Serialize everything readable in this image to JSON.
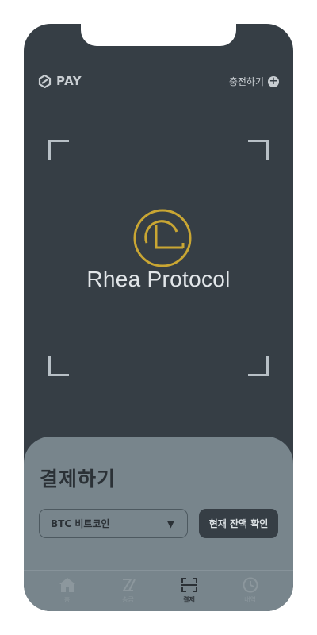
{
  "header": {
    "logo_text": "PAY",
    "charge_label": "충전하기",
    "charge_icon": "plus-circle-icon"
  },
  "scanner": {
    "brand_name": "Rhea Protocol",
    "brand_icon": "rhea-protocol-logo"
  },
  "payment": {
    "title": "결제하기",
    "coin_select_value": "BTC 비트코인",
    "balance_button_label": "현재 잔액 확인"
  },
  "tabs": [
    {
      "label": "홈",
      "icon": "home-icon",
      "active": false
    },
    {
      "label": "송금",
      "icon": "transfer-icon",
      "active": false
    },
    {
      "label": "결제",
      "icon": "scan-icon",
      "active": true
    },
    {
      "label": "내역",
      "icon": "clock-icon",
      "active": false
    }
  ],
  "colors": {
    "background": "#363e45",
    "sheet": "#78858c",
    "brand_gold": "#c9a633",
    "button_dark": "#363e45"
  }
}
